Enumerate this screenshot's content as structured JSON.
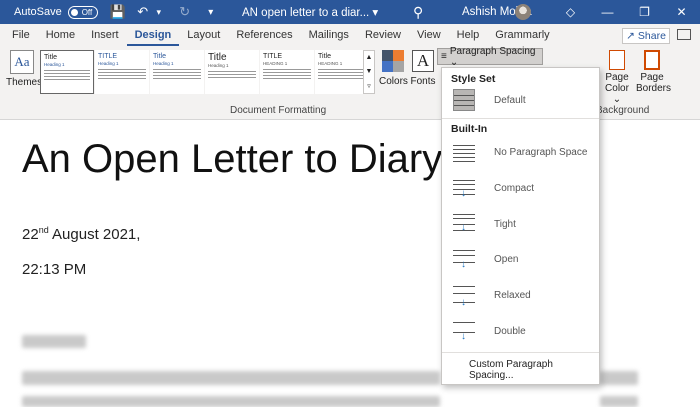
{
  "titlebar": {
    "autosave_label": "AutoSave",
    "autosave_state": "Off",
    "doc_title": "AN open letter to a diar... ▾",
    "user_name": "Ashish Mohta",
    "controls": [
      "◇",
      "—",
      "❐",
      "✕"
    ]
  },
  "menu": {
    "items": [
      "File",
      "Home",
      "Insert",
      "Design",
      "Layout",
      "References",
      "Mailings",
      "Review",
      "View",
      "Help",
      "Grammarly"
    ],
    "share_label": "Share"
  },
  "ribbon": {
    "themes_label": "Themes",
    "themes_glyph": "Aa",
    "style_thumbs": [
      {
        "title": "Title",
        "heading": "Heading 1"
      },
      {
        "title": "TITLE",
        "heading": "Heading 1"
      },
      {
        "title": "Title",
        "heading": "Heading 1"
      },
      {
        "title": "Title",
        "heading": "Heading 1"
      },
      {
        "title": "TITLE",
        "heading": "HEADING 1"
      },
      {
        "title": "Title",
        "heading": "HEADING 1"
      }
    ],
    "colors_label": "Colors",
    "fonts_label": "Fonts",
    "fonts_glyph": "A",
    "paragraph_spacing_label": "Paragraph Spacing ⌄",
    "page_color_label": "Page Color ⌄",
    "page_borders_label": "Page Borders",
    "group_document_formatting": "Document Formatting",
    "group_background": "Background"
  },
  "document": {
    "title": "An Open Letter to Diary –",
    "date_day": "22",
    "date_suffix": "nd",
    "date_rest": " August 2021,",
    "time": "22:13 PM"
  },
  "dropdown": {
    "style_set_header": "Style Set",
    "default_label": "Default",
    "builtin_header": "Built-In",
    "items": [
      "No Paragraph Space",
      "Compact",
      "Tight",
      "Open",
      "Relaxed",
      "Double"
    ],
    "custom_label": "Custom Paragraph Spacing..."
  },
  "colors": {
    "titlebar_bg": "#2b579a",
    "ribbon_bg": "#f3f2f1",
    "accent": "#2b579a",
    "icon_arrow": "#1e73be"
  }
}
